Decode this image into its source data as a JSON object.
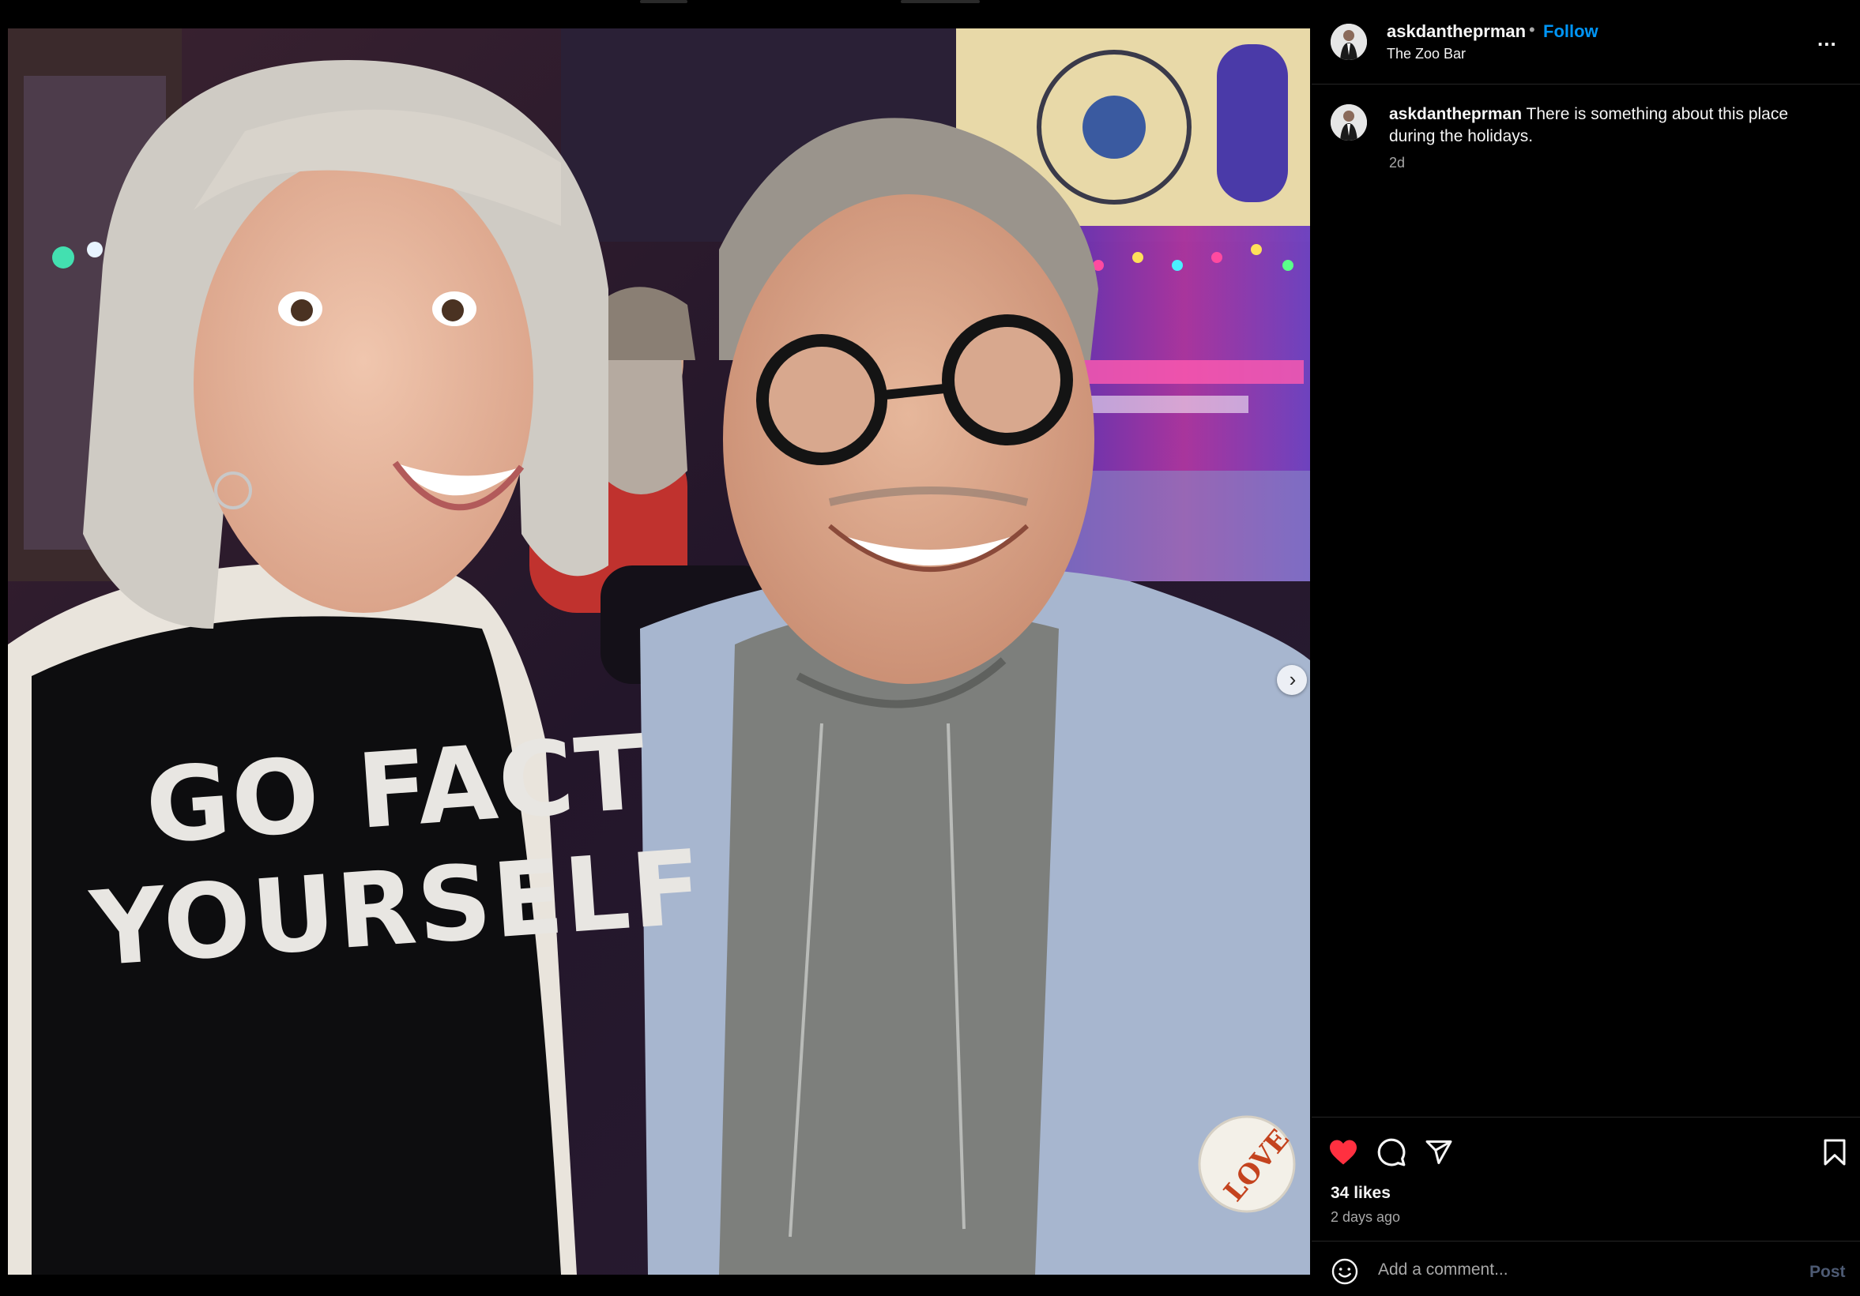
{
  "post": {
    "username": "askdantheprman",
    "separator": "•",
    "follow_label": "Follow",
    "location": "The Zoo Bar",
    "more_label": "...",
    "caption_user": "askdantheprman",
    "caption_text": " There is something about this place during the holidays.",
    "caption_time": "2d",
    "likes_label": "34 likes",
    "date_label": "2 days ago",
    "liked": true,
    "like_color": "#ff3040"
  },
  "media": {
    "shirt_line1": "GO FACT",
    "shirt_line2": "YOURSELF",
    "pin_text": "LOVE",
    "carousel_count": 3,
    "carousel_active": 1
  },
  "comment": {
    "placeholder": "Add a comment...",
    "post_label": "Post"
  },
  "icons": {
    "like": "heart-filled-icon",
    "comment": "comment-bubble-icon",
    "share": "paper-plane-icon",
    "save": "bookmark-icon",
    "emoji": "smiley-icon",
    "next": "chevron-right-icon"
  }
}
